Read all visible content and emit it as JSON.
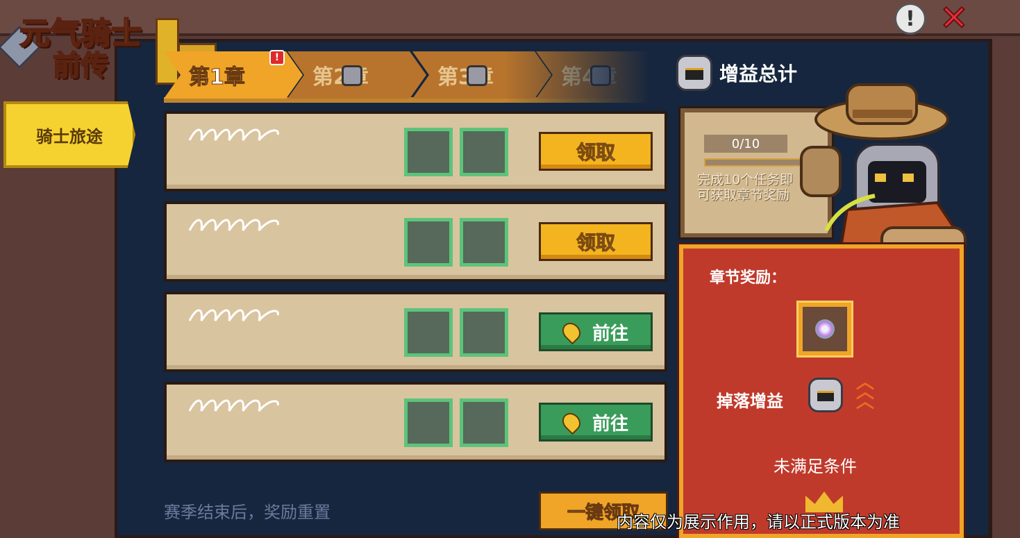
{
  "logo": {
    "line1": "元气骑士",
    "line2": "前传"
  },
  "top_controls": {
    "info_glyph": "!",
    "close_glyph": "✕",
    "icons": [
      "info-icon",
      "close-icon"
    ]
  },
  "side_nav": {
    "items": [
      {
        "label": "骑士旅途",
        "active": true
      }
    ]
  },
  "chapters": {
    "tabs": [
      {
        "label": "第1章",
        "state": "active",
        "alert": true
      },
      {
        "label": "第2章",
        "state": "locked"
      },
      {
        "label": "第3章",
        "state": "locked"
      },
      {
        "label": "第4章",
        "state": "locked"
      }
    ],
    "alert_glyph": "!"
  },
  "tasks": [
    {
      "button_label": "领取",
      "button_type": "claim"
    },
    {
      "button_label": "领取",
      "button_type": "claim"
    },
    {
      "button_label": "前往",
      "button_type": "goto"
    },
    {
      "button_label": "前往",
      "button_type": "goto"
    }
  ],
  "footer": {
    "season_note": "赛季结束后，奖励重置",
    "claim_all_label": "一键领取"
  },
  "bonus_panel": {
    "title": "增益总计",
    "progress_text": "0/10",
    "progress_fraction": 0,
    "description": "完成10个任务即可获取章节奖励"
  },
  "reward_panel": {
    "title": "章节奖励：",
    "drop_label": "掉落增益",
    "status": "未满足条件"
  },
  "disclaimer": "内容仅为展示作用，请以正式版本为准",
  "colors": {
    "accent": "#f0a428",
    "claim_button": "#f4b420",
    "goto_button": "#3a9c5a",
    "panel_bg": "#16263e",
    "reward_bg": "#c03a2c"
  }
}
